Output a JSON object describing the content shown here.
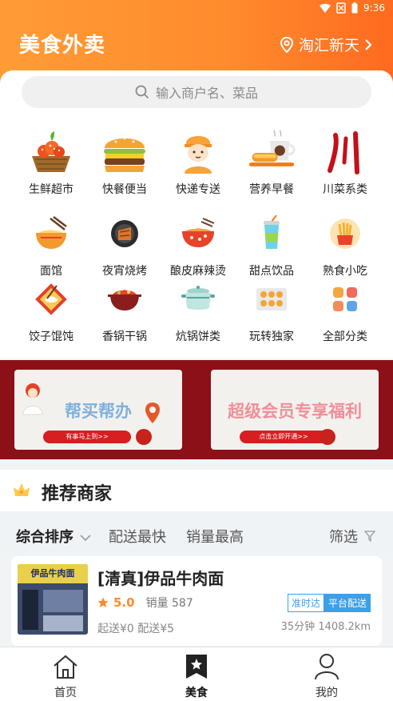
{
  "status_bar": {
    "time": "9:36"
  },
  "header": {
    "title": "美食外卖",
    "location": "淘汇新天"
  },
  "search": {
    "placeholder": "输入商户名、菜品"
  },
  "categories": [
    {
      "label": "生鲜超市",
      "icon": "fresh-market-icon"
    },
    {
      "label": "快餐便当",
      "icon": "burger-icon"
    },
    {
      "label": "快递专送",
      "icon": "courier-icon"
    },
    {
      "label": "营养早餐",
      "icon": "breakfast-icon"
    },
    {
      "label": "川菜系类",
      "icon": "sichuan-icon"
    },
    {
      "label": "面馆",
      "icon": "noodles-icon"
    },
    {
      "label": "夜宵烧烤",
      "icon": "bbq-icon"
    },
    {
      "label": "酿皮麻辣烫",
      "icon": "spicy-soup-icon"
    },
    {
      "label": "甜点饮品",
      "icon": "drink-icon"
    },
    {
      "label": "熟食小吃",
      "icon": "fries-icon"
    },
    {
      "label": "饺子馄饨",
      "icon": "dumpling-icon"
    },
    {
      "label": "香锅干锅",
      "icon": "hotpot-icon"
    },
    {
      "label": "炕锅饼类",
      "icon": "pot-icon"
    },
    {
      "label": "玩转独家",
      "icon": "exclusive-icon"
    },
    {
      "label": "全部分类",
      "icon": "all-categories-icon"
    }
  ],
  "banners": [
    {
      "title": "帮买帮办",
      "button": "有事马上到>>"
    },
    {
      "title": "超级会员专享福利",
      "button": "点击立即开通>>"
    }
  ],
  "recommend": {
    "title": "推荐商家"
  },
  "sort_bar": {
    "items": [
      "综合排序",
      "配送最快",
      "销量最高"
    ],
    "filter": "筛选"
  },
  "shop": {
    "name": "[清真]伊品牛肉面",
    "sign": "伊品牛肉面",
    "score": "5.0",
    "sales": "销量 587",
    "tags": [
      "准时达",
      "平台配送"
    ],
    "fees": "起送¥0  配送¥5",
    "delivery": "35分钟 1408.2km"
  },
  "tabs": [
    {
      "label": "首页",
      "icon": "home-icon"
    },
    {
      "label": "美食",
      "icon": "food-bookmark-icon"
    },
    {
      "label": "我的",
      "icon": "user-icon"
    }
  ],
  "colors": {
    "accent": "#ff8a2c",
    "tag_blue": "#3aa0ea",
    "banner_bg": "#8c1018"
  }
}
